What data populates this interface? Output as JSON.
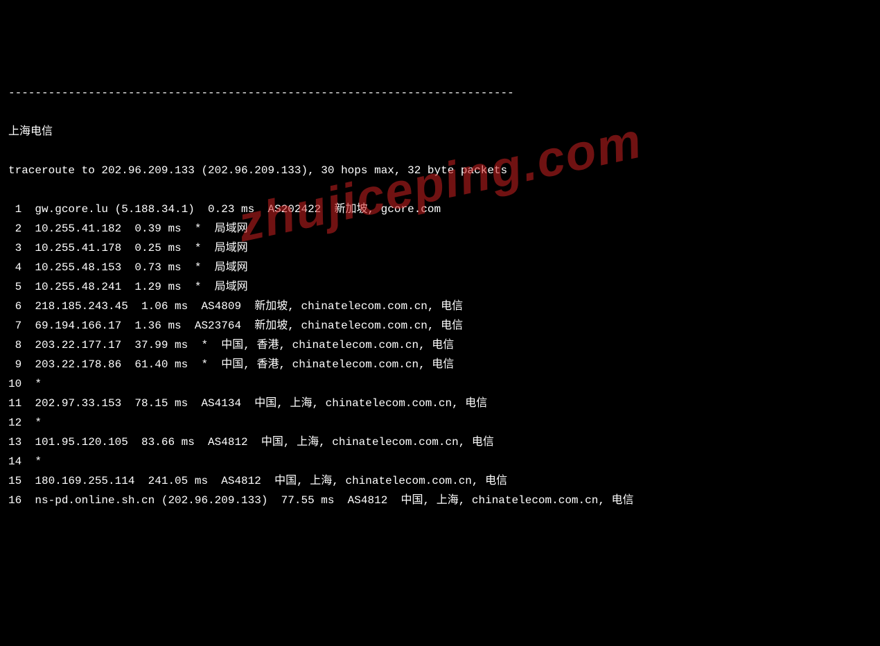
{
  "divider": "----------------------------------------------------------------------------",
  "title": "上海电信",
  "traceroute_header": "traceroute to 202.96.209.133 (202.96.209.133), 30 hops max, 32 byte packets",
  "watermark": "zhujiceping.com",
  "hops": [
    {
      "n": " 1",
      "rest": "  gw.gcore.lu (5.188.34.1)  0.23 ms  AS202422  新加坡, gcore.com"
    },
    {
      "n": " 2",
      "rest": "  10.255.41.182  0.39 ms  *  局域网"
    },
    {
      "n": " 3",
      "rest": "  10.255.41.178  0.25 ms  *  局域网"
    },
    {
      "n": " 4",
      "rest": "  10.255.48.153  0.73 ms  *  局域网"
    },
    {
      "n": " 5",
      "rest": "  10.255.48.241  1.29 ms  *  局域网"
    },
    {
      "n": " 6",
      "rest": "  218.185.243.45  1.06 ms  AS4809  新加坡, chinatelecom.com.cn, 电信"
    },
    {
      "n": " 7",
      "rest": "  69.194.166.17  1.36 ms  AS23764  新加坡, chinatelecom.com.cn, 电信"
    },
    {
      "n": " 8",
      "rest": "  203.22.177.17  37.99 ms  *  中国, 香港, chinatelecom.com.cn, 电信"
    },
    {
      "n": " 9",
      "rest": "  203.22.178.86  61.40 ms  *  中国, 香港, chinatelecom.com.cn, 电信"
    },
    {
      "n": "10",
      "rest": "  *"
    },
    {
      "n": "11",
      "rest": "  202.97.33.153  78.15 ms  AS4134  中国, 上海, chinatelecom.com.cn, 电信"
    },
    {
      "n": "12",
      "rest": "  *"
    },
    {
      "n": "13",
      "rest": "  101.95.120.105  83.66 ms  AS4812  中国, 上海, chinatelecom.com.cn, 电信"
    },
    {
      "n": "14",
      "rest": "  *"
    },
    {
      "n": "15",
      "rest": "  180.169.255.114  241.05 ms  AS4812  中国, 上海, chinatelecom.com.cn, 电信"
    },
    {
      "n": "16",
      "rest": "  ns-pd.online.sh.cn (202.96.209.133)  77.55 ms  AS4812  中国, 上海, chinatelecom.com.cn, 电信"
    }
  ]
}
